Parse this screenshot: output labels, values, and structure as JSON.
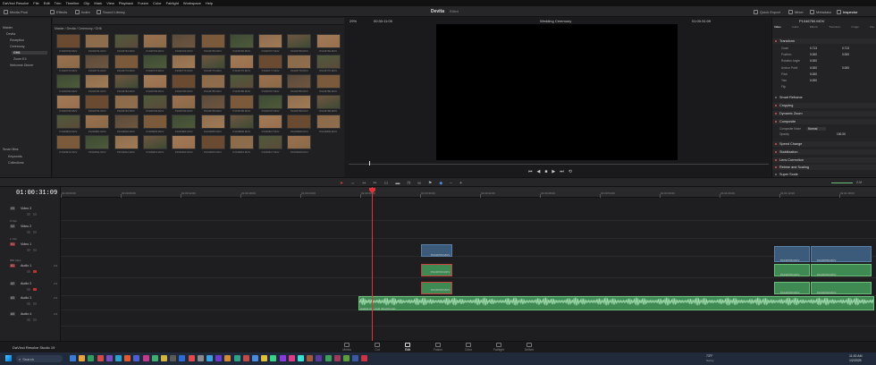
{
  "titlebar": {
    "app_name": "DaVinci Resolve",
    "menu": [
      "File",
      "Edit",
      "Trim",
      "Timeline",
      "Clip",
      "Mark",
      "View",
      "Playback",
      "Fusion",
      "Color",
      "Fairlight",
      "Workspace",
      "Help"
    ]
  },
  "toolbar": {
    "left": [
      "Media Pool",
      "Effects",
      "Index",
      "Sound Library"
    ],
    "right": [
      "Quick Export",
      "Mixer",
      "Metadata",
      "Inspector"
    ],
    "project_title": "Devita",
    "project_state": "Edited"
  },
  "bins": {
    "master": "Master",
    "items": [
      "Devita",
      "Reception",
      "Ceremony",
      "GH6",
      "Zoom E4",
      "Welcome Dinner"
    ],
    "smart_bins": "Smart Bins",
    "smart_items": [
      "Keywords",
      "Collections"
    ]
  },
  "media_pool": {
    "path": "Master / Devita / Ceremony / GH6",
    "rows": [
      [
        "P1046760.MOV",
        "P1046761.MOV",
        "P1046762.MOV",
        "P1046763.MOV",
        "P1046764.MOV",
        "P1046765.MOV",
        "P1046766.MOV",
        "P1046767.MOV",
        "P1046768.MOV",
        "P1046769.MOV"
      ],
      [
        "P1046770.MOV",
        "P1046771.MOV",
        "P1046772.MOV",
        "P1046773.MOV",
        "P1046774.MOV",
        "P1046775.MOV",
        "P1046776.MOV",
        "P1046777.MOV",
        "P1046778.MOV",
        "P1046779.MOV"
      ],
      [
        "P1046780.MOV",
        "P1046781.MOV",
        "P1046782.MOV",
        "P1046783.MOV",
        "P1046784.MOV",
        "P1046785.MOV",
        "P1046786.MOV",
        "P1046787.MOV",
        "P1046788.MOV",
        "P1046789.MOV"
      ],
      [
        "P1046790.MOV",
        "P1046791.MOV",
        "P1046792.MOV",
        "P1046793.MOV",
        "P1046794.MOV",
        "P1046795.MOV",
        "P1046796.MOV",
        "P1046797.MOV",
        "P1046798.MOV",
        "P1046799.MOV"
      ],
      [
        "P1046800.MOV",
        "P1046801.MOV",
        "P1046802.MOV",
        "P1046803.MOV",
        "P1046804.MOV",
        "P1046805.MOV",
        "P1046806.MOV",
        "P1046807.MOV",
        "P1046808.MOV",
        "P1046809.MOV"
      ],
      [
        "P1046810.MOV",
        "P1046811.MOV",
        "P1046812.MOV",
        "P1046813.MOV",
        "P1046814.MOV",
        "P1046815.MOV",
        "P1046816.MOV",
        "P1046817.MOV",
        "P1046818.MOV"
      ]
    ]
  },
  "viewer": {
    "zoom": "29%",
    "timecode_left": "00:30:11:05",
    "timeline_name": "Wedding Ceremony",
    "timecode_right": "01:00:31:09"
  },
  "inspector": {
    "clip_name": "P1046760.MOV",
    "tabs": [
      "Video",
      "Audio",
      "Effects",
      "Transition",
      "Image",
      "File"
    ],
    "transform_label": "Transform",
    "rows": [
      {
        "label": "Zoom",
        "x": "0.713",
        "y": "0.713"
      },
      {
        "label": "Position",
        "x": "0.000",
        "y": "0.000"
      },
      {
        "label": "Rotation Angle",
        "x": "0.000",
        "y": ""
      },
      {
        "label": "Anchor Point",
        "x": "0.000",
        "y": "0.000"
      },
      {
        "label": "Pitch",
        "x": "0.000",
        "y": ""
      },
      {
        "label": "Yaw",
        "x": "0.000",
        "y": ""
      },
      {
        "label": "Flip",
        "x": "",
        "y": ""
      }
    ],
    "sections": [
      "Smart Reframe",
      "Cropping",
      "Dynamic Zoom",
      "Composite",
      "Speed Change",
      "Stabilization",
      "Lens Correction",
      "Retime and Scaling",
      "Super Scale"
    ],
    "composite_mode_label": "Composite Mode",
    "composite_mode": "Normal",
    "opacity_label": "Opacity",
    "opacity": "100.00"
  },
  "timeline": {
    "timecode": "01:00:31:09",
    "ruler": [
      "01:00:00:00",
      "01:00:06:00",
      "01:00:12:00",
      "01:00:18:00",
      "01:00:24:00",
      "01:00:30:00",
      "01:00:36:00",
      "01:00:42:00",
      "01:00:48:00",
      "01:00:54:00",
      "01:01:00:00",
      "01:01:06:00",
      "01:01:12:00",
      "01:01:18:00"
    ],
    "tracks": [
      {
        "id": "V3",
        "name": "Video 3",
        "clips": ""
      },
      {
        "id": "V2",
        "name": "Video 2",
        "clips": "0 Clip"
      },
      {
        "id": "V1",
        "name": "Video 1",
        "clips": "1 Clip"
      },
      {
        "id": "A1",
        "name": "Audio 1",
        "clips": "999 Clips",
        "ch": "2.0"
      },
      {
        "id": "A2",
        "name": "Audio 2",
        "ch": "2.0"
      },
      {
        "id": "A3",
        "name": "Audio 3",
        "ch": "2.0"
      },
      {
        "id": "A4",
        "name": "Audio 4",
        "ch": "2.0"
      }
    ],
    "clip_mid": "P1046760.MOV",
    "clip_right_a": "P1046765.MOV",
    "clip_right_b": "P1046766.MOV",
    "audio_long": "Audio3 4x - Cold (Devita).wav",
    "zoom_label": "Z-M"
  },
  "pages": [
    "Media",
    "Cut",
    "Edit",
    "Fusion",
    "Color",
    "Fairlight",
    "Deliver"
  ],
  "active_page": "Edit",
  "statusbar": {
    "app": "DaVinci Resolve Studio 19"
  },
  "taskbar": {
    "search": "Search",
    "weather": "73°F",
    "weather_sub": "Sunny",
    "time": "11:00 AM",
    "date": "1/2/2025"
  }
}
